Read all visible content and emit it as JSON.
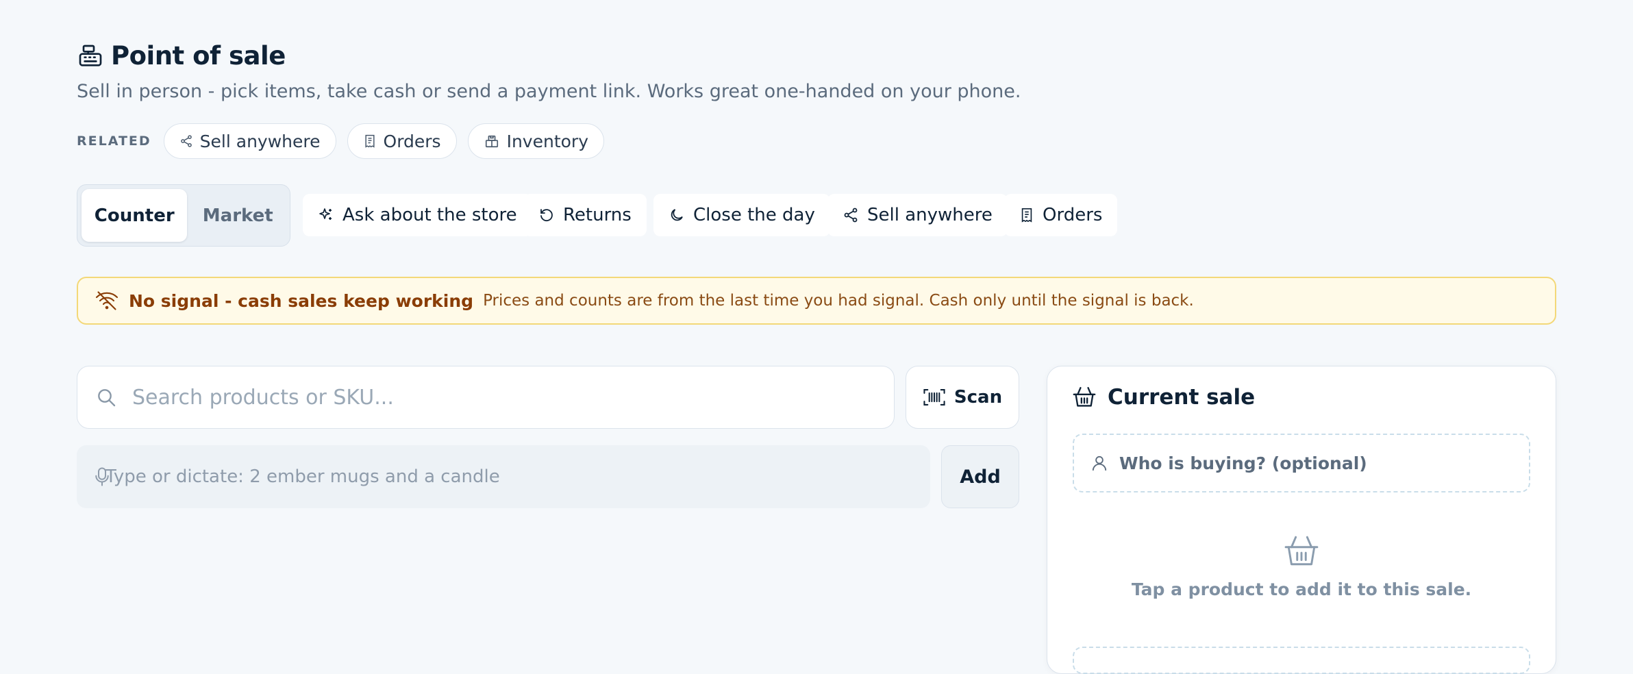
{
  "header": {
    "title": "Point of sale",
    "title_icon": "cash-register-icon",
    "subtitle": "Sell in person - pick items, take cash or send a payment link. Works great one-handed on your phone."
  },
  "related": {
    "label": "RELATED",
    "links": [
      {
        "label": "Sell anywhere",
        "icon": "share-icon"
      },
      {
        "label": "Orders",
        "icon": "receipt-icon"
      },
      {
        "label": "Inventory",
        "icon": "boxes-icon"
      }
    ]
  },
  "mode_tabs": [
    {
      "label": "Counter",
      "selected": true
    },
    {
      "label": "Market",
      "selected": false
    }
  ],
  "toolbar": [
    {
      "label": "Ask about the store",
      "icon": "sparkles-icon"
    },
    {
      "label": "Returns",
      "icon": "undo-icon"
    },
    {
      "label": "Close the day",
      "icon": "moon-icon"
    },
    {
      "label": "Sell anywhere",
      "icon": "share-icon"
    },
    {
      "label": "Orders",
      "icon": "receipt-icon"
    }
  ],
  "banner": {
    "icon": "no-signal-icon",
    "title": "No signal - cash sales keep working",
    "text": "Prices and counts are from the last time you had signal. Cash only until the signal is back."
  },
  "search": {
    "placeholder": "Search products or SKU...",
    "value": "",
    "scan_label": "Scan"
  },
  "dictate": {
    "placeholder": "Type or dictate: 2 ember mugs and a candle",
    "value": "",
    "add_label": "Add"
  },
  "sale": {
    "title": "Current sale",
    "buyer_label": "Who is buying? (optional)",
    "empty_text": "Tap a product to add it to this sale."
  },
  "colors": {
    "background": "#f5f8fb",
    "text": "#0f2236",
    "muted": "#5b6b7d",
    "banner_bg": "#fffae8",
    "banner_border": "#f3d878",
    "banner_text": "#8a3d06"
  }
}
